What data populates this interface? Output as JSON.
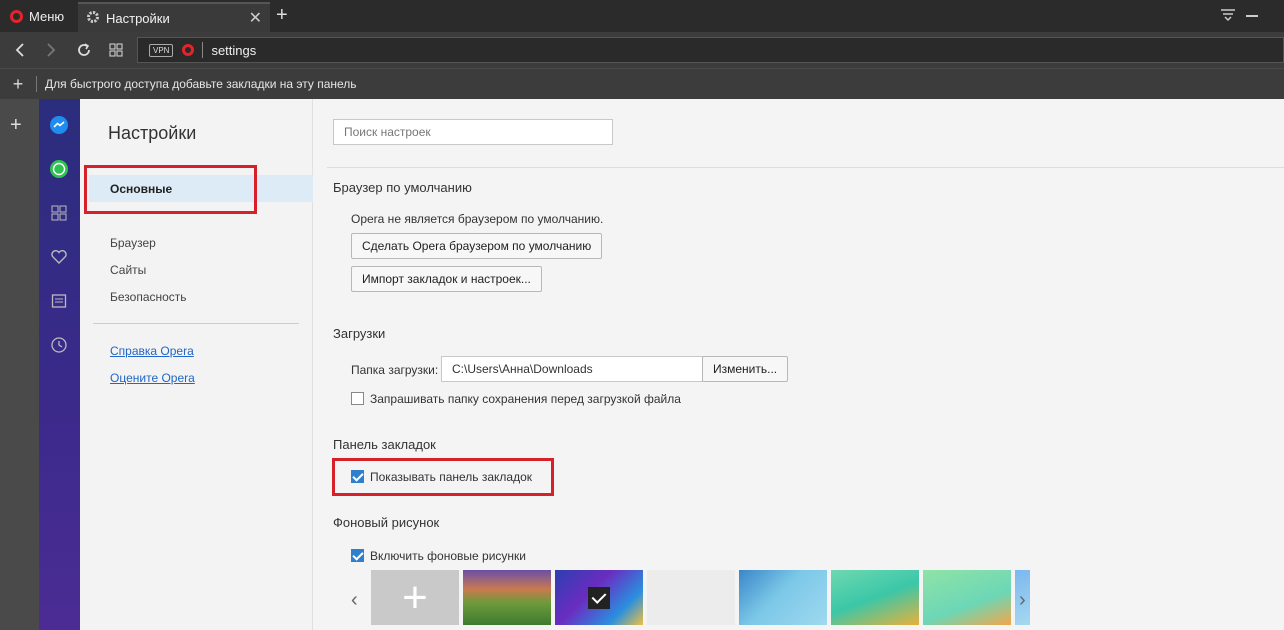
{
  "tabstrip": {
    "menu_label": "Меню",
    "tab_title": "Настройки",
    "close_glyph": "✕",
    "new_tab_glyph": "+"
  },
  "addressbar": {
    "vpn_label": "VPN",
    "url": "settings"
  },
  "bookmarks_bar": {
    "hint": "Для быстрого доступа добавьте закладки на эту панель"
  },
  "settings_nav": {
    "title": "Настройки",
    "items": [
      {
        "label": "Основные",
        "active": true
      },
      {
        "label": "Браузер"
      },
      {
        "label": "Сайты"
      },
      {
        "label": "Безопасность"
      }
    ],
    "links": [
      {
        "label": "Справка Opera"
      },
      {
        "label": "Оцените Opera"
      }
    ]
  },
  "search": {
    "placeholder": "Поиск настроек"
  },
  "default_browser": {
    "title": "Браузер по умолчанию",
    "status": "Opera не является браузером по умолчанию.",
    "make_default_button": "Сделать Opera браузером по умолчанию",
    "import_button": "Импорт закладок и настроек..."
  },
  "downloads": {
    "title": "Загрузки",
    "folder_label": "Папка загрузки:",
    "folder_value": "C:\\Users\\Анна\\Downloads",
    "change_button": "Изменить...",
    "ask_checkbox_label": "Запрашивать папку сохранения перед загрузкой файла",
    "ask_checked": false
  },
  "bookmarks_panel": {
    "title": "Панель закладок",
    "show_checkbox_label": "Показывать панель закладок",
    "show_checked": true
  },
  "wallpaper": {
    "title": "Фоновый рисунок",
    "enable_checkbox_label": "Включить фоновые рисунки",
    "enable_checked": true,
    "selected_index": 2
  },
  "colors": {
    "accent_red": "#d6202a",
    "link_blue": "#2166c8",
    "checkbox_blue": "#2f7fcf"
  }
}
